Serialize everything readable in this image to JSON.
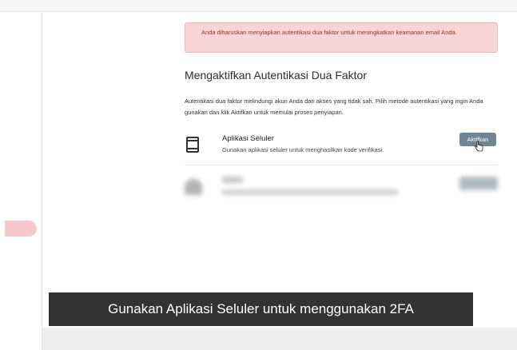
{
  "alert": {
    "message": "Anda diharuskan menyiapkan autentikasi dua faktor untuk meningkatkan keamanan email Anda."
  },
  "section": {
    "title": "Mengaktifkan Autentikasi Dua Faktor",
    "description": "Autentikasi dua faktor melindungi akun Anda dari akses yang tidak sah. Pilih metode autentikasi yang ingin Anda gunakan dan klik Aktifkan untuk memulai proses penyiapan."
  },
  "methods": [
    {
      "icon": "mobile-device-icon",
      "name": "Aplikasi Seluler",
      "description": "Gunakan aplikasi seluler untuk menghasilkan kode verifikasi.",
      "button_label": "Aktifkan"
    }
  ],
  "caption": "Gunakan Aplikasi Seluler untuk menggunakan 2FA",
  "colors": {
    "alert_bg": "#f9d6d6",
    "alert_text": "#9b2b2b",
    "button": "#6f8593",
    "caption_bg": "#333333",
    "sidebar_active": "#f8c9cc"
  }
}
